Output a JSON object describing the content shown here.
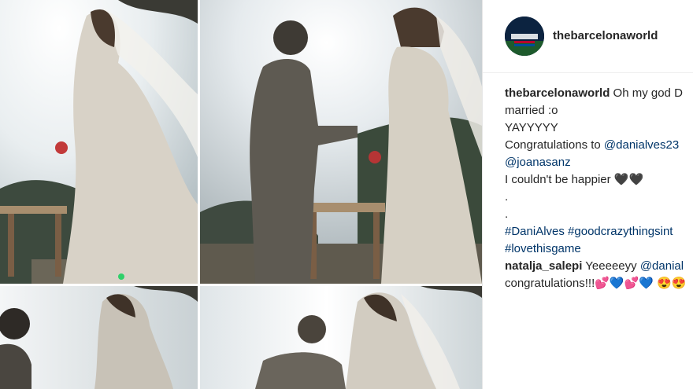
{
  "post": {
    "username": "thebarcelonaworld",
    "avatar_text": "BARCELONA WORLD"
  },
  "caption": {
    "author": "thebarcelonaworld",
    "line1_rest": "Oh my god D",
    "line2": "married :o",
    "line3": "YAYYYYY",
    "line4_prefix": "Congratulations to",
    "mention1": "@danialves23",
    "mention2": "@joanasanz",
    "line6": "I couldn't be happier",
    "hearts": "🖤🖤",
    "dot1": ".",
    "dot2": ".",
    "hashtag1": "#DaniAlves",
    "hashtag2": "#goodcrazythingsint",
    "hashtag3": "#lovethisgame"
  },
  "comment": {
    "author": "natalja_salepi",
    "text": "Yeeeeeyy",
    "mention": "@danial",
    "line2": "congratulations!!!",
    "emojis": "💕💙💕💙 😍😍"
  },
  "colors": {
    "mention": "#003569",
    "text": "#262626"
  }
}
